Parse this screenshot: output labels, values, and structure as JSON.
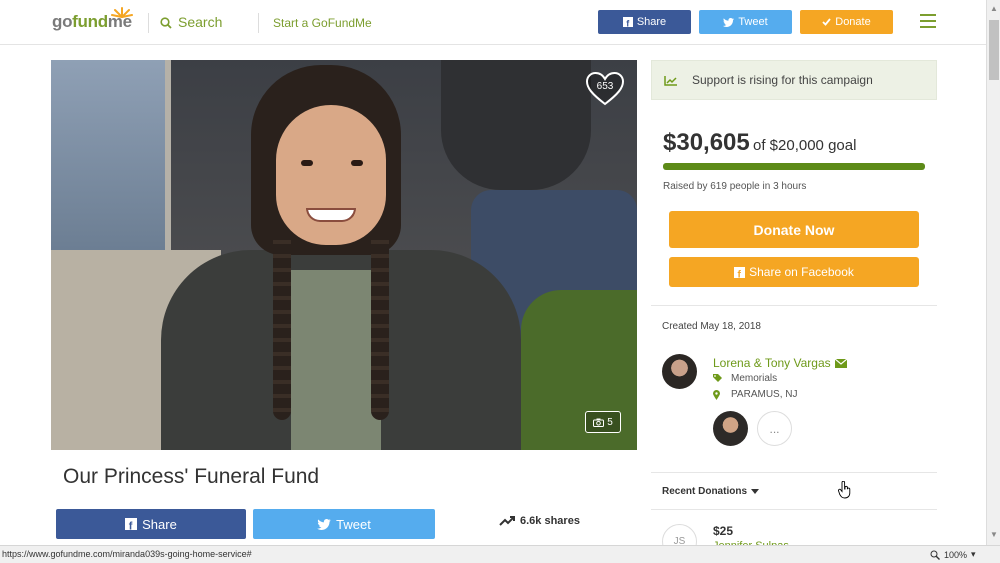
{
  "header": {
    "logo_go": "go",
    "logo_fund": "fund",
    "logo_me": "me",
    "search_label": "Search",
    "start_label": "Start a GoFundMe",
    "share_label": "Share",
    "tweet_label": "Tweet",
    "donate_label": "Donate"
  },
  "photo": {
    "heart_count": "653",
    "photo_count": "5"
  },
  "campaign": {
    "title": "Our Princess' Funeral Fund",
    "share_label": "Share",
    "tweet_label": "Tweet",
    "shares_label": "6.6k shares"
  },
  "sidebar": {
    "rising_text": "Support is rising for this campaign",
    "amount_raised": "$30,605",
    "goal_text": "of $20,000 goal",
    "progress_fraction": 1.0,
    "raised_by": "Raised by 619 people in 3 hours",
    "donate_now_label": "Donate Now",
    "share_facebook_label": "Share on Facebook",
    "created": "Created May 18, 2018",
    "organizer_name": "Lorena & Tony Vargas",
    "category": "Memorials",
    "location": "PARAMUS, NJ",
    "more_label": "...",
    "recent_donations_label": "Recent Donations",
    "donation_initials": "JS",
    "donation_amount": "$25",
    "donation_name": "Jennifer Sulpas"
  },
  "statusbar": {
    "url": "https://www.gofundme.com/miranda039s-going-home-service#",
    "zoom": "100%"
  },
  "colors": {
    "brand_green": "#7c9e2f",
    "facebook": "#3b5998",
    "twitter": "#55acee",
    "donate_orange": "#f5a623",
    "progress_green": "#5d8b18"
  }
}
